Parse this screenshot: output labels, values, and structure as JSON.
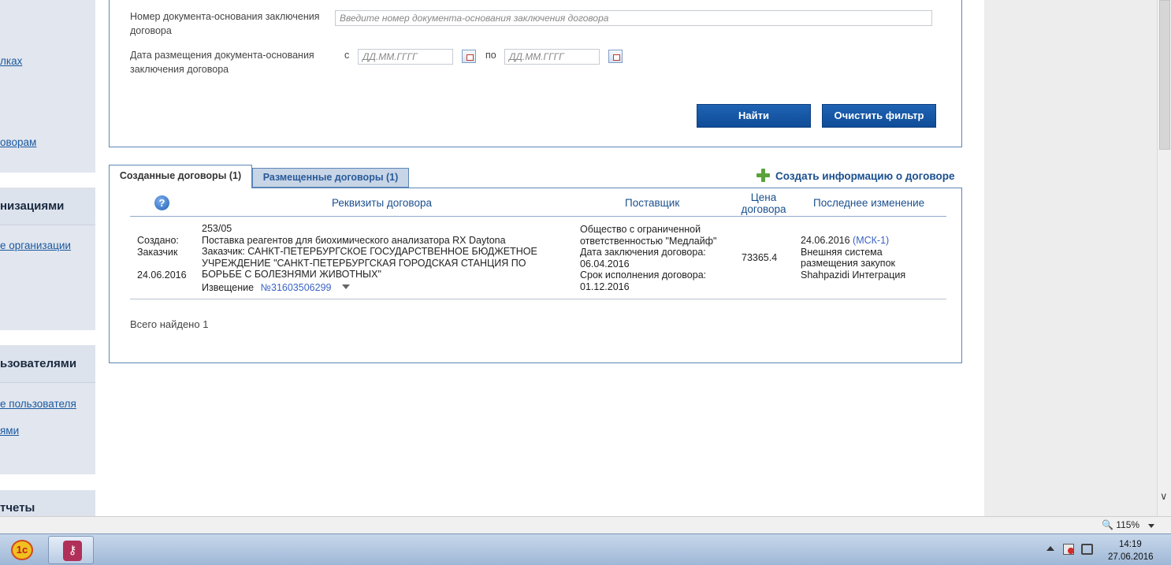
{
  "sidebar": {
    "link1": "лках",
    "link2": "оворам",
    "section2_title": "низациями",
    "link3": "е организации",
    "section3_title": "ьзователями",
    "link4": "е пользователя",
    "link5": "ями",
    "section4_title": "тчеты"
  },
  "filter": {
    "doc_number_label_line1": "Номер документа-основания заключения",
    "doc_number_label_line2": "договора",
    "doc_number_placeholder": "Введите номер документа-основания заключения договора",
    "date_label_line1": "Дата размещения документа-основания",
    "date_label_line2": "заключения договора",
    "from_label": "с",
    "to_label": "по",
    "date_placeholder": "ДД.ММ.ГГГГ",
    "find_button": "Найти",
    "clear_button": "Очистить фильтр"
  },
  "tabs": {
    "created": "Созданные договоры (1)",
    "placed": "Размещенные договоры (1)"
  },
  "create_link": "Создать информацию о договоре",
  "table": {
    "help": "?",
    "col_details": "Реквизиты договора",
    "col_supplier": "Поставщик",
    "col_price_line1": "Цена",
    "col_price_line2": "договора",
    "col_last_change": "Последнее изменение"
  },
  "row": {
    "status_line1": "Создано:",
    "status_line2": "Заказчик",
    "created_date": "24.06.2016",
    "number": "253/05",
    "subject": "Поставка реагентов для биохимического анализатора RX Daytona",
    "customer_line1": "Заказчик: САНКТ-ПЕТЕРБУРГСКОЕ ГОСУДАРСТВЕННОЕ БЮДЖЕТНОЕ",
    "customer_line2": "УЧРЕЖДЕНИЕ \"САНКТ-ПЕТЕРБУРГСКАЯ ГОРОДСКАЯ СТАНЦИЯ ПО",
    "customer_line3": "БОРЬБЕ С БОЛЕЗНЯМИ ЖИВОТНЫХ\"",
    "notice_label": "Извещение",
    "notice_link": "№31603506299",
    "supplier_line1": "Общество с ограниченной",
    "supplier_line2": "ответственностью \"Медлайф\"",
    "conclusion_label": "Дата заключения договора:",
    "conclusion_date": "06.04.2016",
    "execution_label": "Срок исполнения договора:",
    "execution_date": "01.12.2016",
    "price": "73365.4",
    "change_date": "24.06.2016",
    "change_user": "(МСК-1)",
    "change_line2": "Внешняя система",
    "change_line3": "размещения закупок",
    "change_line4": "Shahpazidi Интеграция"
  },
  "total_found": "Всего найдено 1",
  "statusbar": {
    "zoom": "115%"
  },
  "taskbar": {
    "app1_icon_text": "1с",
    "time": "14:19",
    "date": "27.06.2016"
  },
  "colors": {
    "accent": "#1a4f8f",
    "button": "#1559a8",
    "panel_border": "#5b86b8",
    "plus_icon": "#5aa23a"
  }
}
